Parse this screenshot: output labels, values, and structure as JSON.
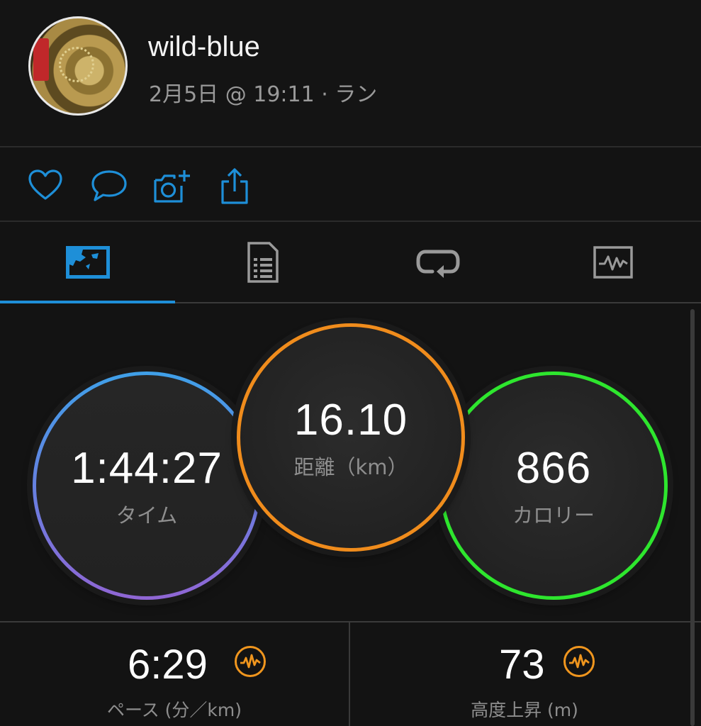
{
  "header": {
    "username": "wild-blue",
    "meta": "2月5日 @ 19:11 · ラン"
  },
  "actions": [
    {
      "icon": "heart-icon"
    },
    {
      "icon": "comment-icon"
    },
    {
      "icon": "add-photo-icon"
    },
    {
      "icon": "share-icon"
    }
  ],
  "tabs": [
    {
      "icon": "overview-map-icon",
      "active": true
    },
    {
      "icon": "stats-list-icon",
      "active": false
    },
    {
      "icon": "laps-icon",
      "active": false
    },
    {
      "icon": "charts-icon",
      "active": false
    }
  ],
  "summary": {
    "time": {
      "value": "1:44:27",
      "label": "タイム"
    },
    "distance": {
      "value": "16.10",
      "label": "距離（km）"
    },
    "calories": {
      "value": "866",
      "label": "カロリー"
    }
  },
  "stats": [
    {
      "value": "6:29",
      "label": "ペース (分／km)"
    },
    {
      "value": "73",
      "label": "高度上昇 (m)"
    }
  ],
  "colors": {
    "accent": "#1e8fd8",
    "time_ring_top": "#3fa0e8",
    "time_ring_bottom": "#9066d4",
    "distance_ring": "#f08c1c",
    "calories_ring": "#2ee62e",
    "badge": "#f0961e"
  }
}
